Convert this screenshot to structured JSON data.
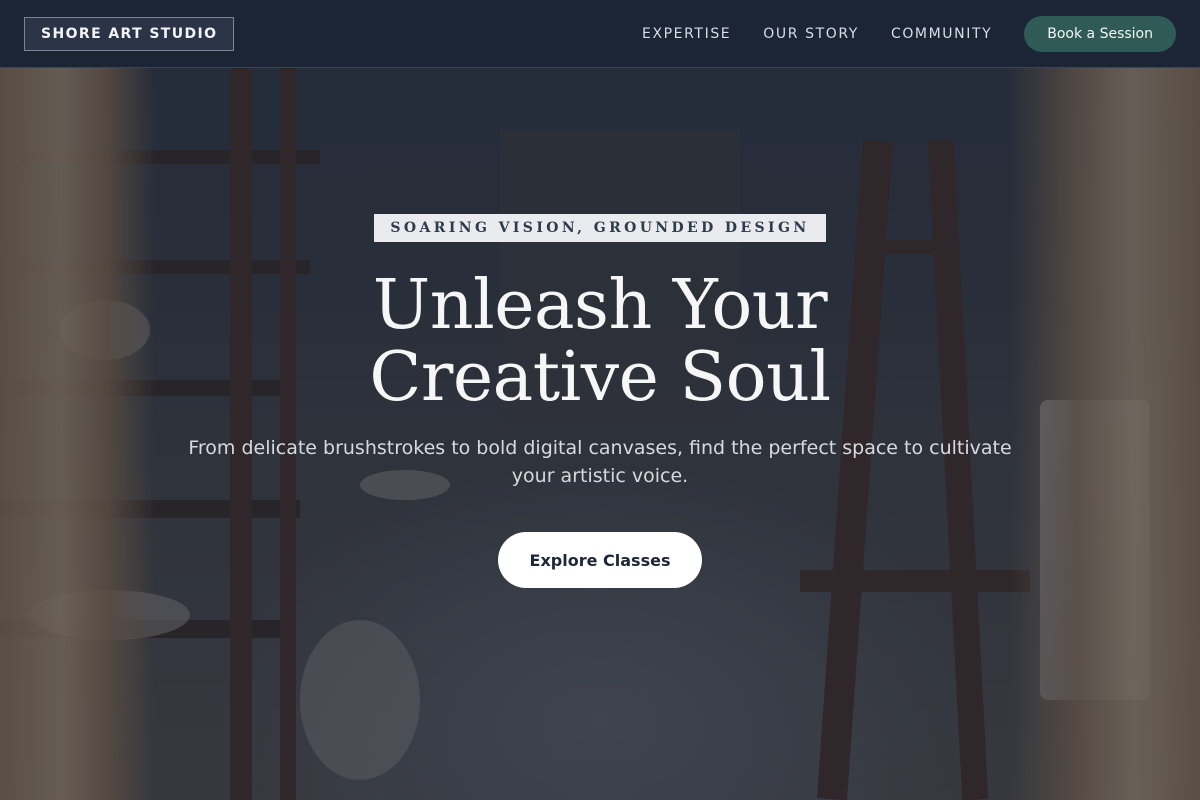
{
  "header": {
    "logo_text": "SHORE ART STUDIO",
    "nav": [
      {
        "label": "EXPERTISE"
      },
      {
        "label": "OUR STORY"
      },
      {
        "label": "COMMUNITY"
      }
    ],
    "cta_label": "Book a Session"
  },
  "hero": {
    "tagline": "SOARING VISION, GROUNDED DESIGN",
    "headline": "Unleash Your Creative Soul",
    "subtext": "From delicate brushstrokes to bold digital canvases, find the perfect space to cultivate your artistic voice.",
    "button_label": "Explore Classes"
  },
  "colors": {
    "header_bg": "#1c2535",
    "cta_bg": "#2f5a55",
    "overlay": "#192130",
    "text_light": "#f6f6f6"
  }
}
